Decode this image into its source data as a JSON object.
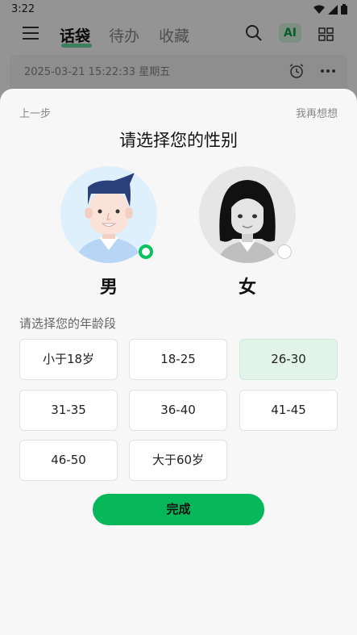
{
  "status_bar": {
    "time": "3:22"
  },
  "header": {
    "tabs": [
      {
        "label": "话袋",
        "active": true
      },
      {
        "label": "待办",
        "active": false
      },
      {
        "label": "收藏",
        "active": false
      }
    ],
    "ai_label": "AI"
  },
  "note_card": {
    "datetime": "2025-03-21 15:22:33 星期五"
  },
  "sheet": {
    "prev_label": "上一步",
    "think_label": "我再想想",
    "title": "请选择您的性别",
    "genders": [
      {
        "label": "男",
        "selected": true
      },
      {
        "label": "女",
        "selected": false
      }
    ],
    "age_heading": "请选择您的年龄段",
    "age_options": [
      {
        "label": "小于18岁",
        "selected": false
      },
      {
        "label": "18-25",
        "selected": false
      },
      {
        "label": "26-30",
        "selected": true
      },
      {
        "label": "31-35",
        "selected": false
      },
      {
        "label": "36-40",
        "selected": false
      },
      {
        "label": "41-45",
        "selected": false
      },
      {
        "label": "46-50",
        "selected": false
      },
      {
        "label": "大于60岁",
        "selected": false
      }
    ],
    "done_label": "完成"
  },
  "colors": {
    "accent": "#07c160",
    "selected_age_bg": "#e2f3ea",
    "male_avatar_bg": "#def0fc",
    "female_avatar_bg": "#e6e6e6"
  },
  "icons": [
    "menu-icon",
    "search-icon",
    "grid-icon",
    "alarm-icon",
    "more-icon",
    "wifi-icon",
    "signal-icon",
    "battery-icon"
  ]
}
